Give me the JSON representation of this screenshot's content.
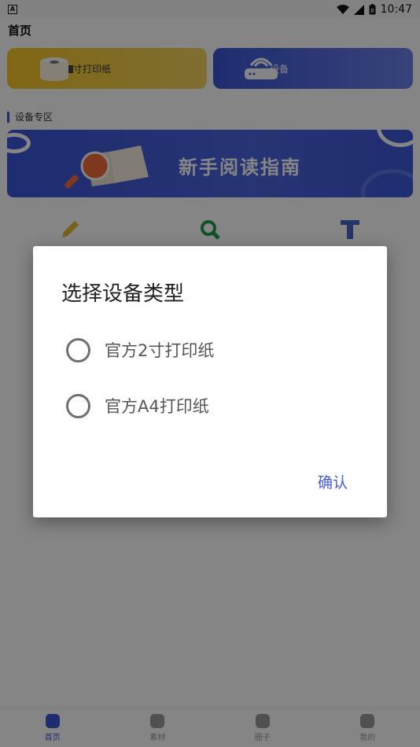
{
  "status_bar": {
    "time": "10:47",
    "app_badge": "A",
    "battery": "B"
  },
  "header": {
    "title": "首页"
  },
  "cards": [
    {
      "label": "寸打印纸"
    },
    {
      "label": "设备"
    }
  ],
  "section": {
    "title": "设备专区"
  },
  "banner": {
    "text": "新手阅读指南"
  },
  "nav": [
    {
      "label": "首页",
      "active": true
    },
    {
      "label": "素材"
    },
    {
      "label": "圈子"
    },
    {
      "label": "我的"
    }
  ],
  "dialog": {
    "title": "选择设备类型",
    "options": [
      {
        "label": "官方2寸打印纸",
        "selected": false
      },
      {
        "label": "官方A4打印纸",
        "selected": false
      }
    ],
    "confirm": "确认"
  },
  "colors": {
    "accent": "#3d55d5",
    "paper_card": "#f7c628",
    "scrim": "rgba(0,0,0,0.48)"
  }
}
